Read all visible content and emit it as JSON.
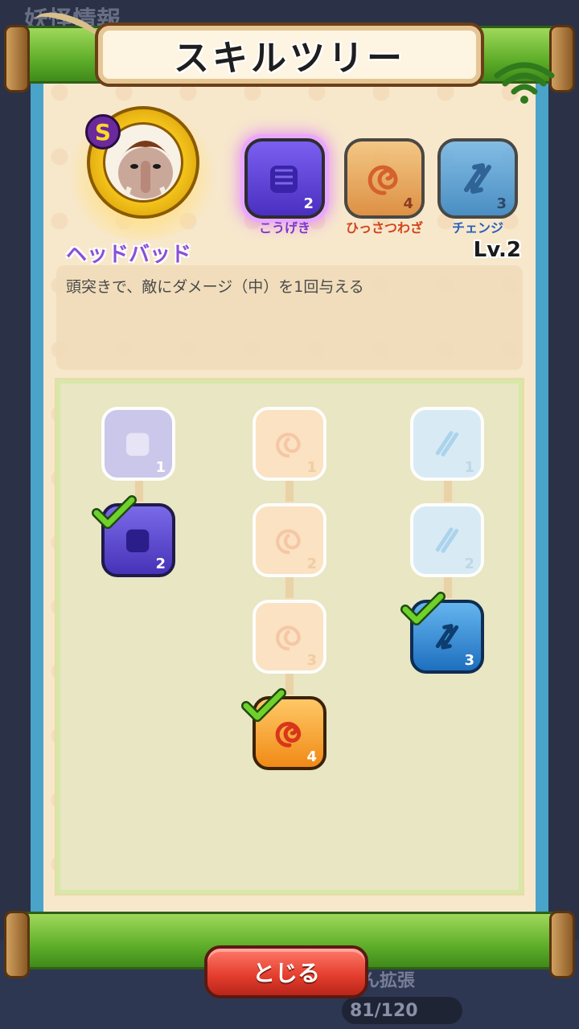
{
  "backdrop": {
    "title": "妖怪情報",
    "expand_label": "ん拡張",
    "capacity": "81/120"
  },
  "header": {
    "title": "スキルツリー"
  },
  "character": {
    "rank": "S",
    "icon": "mammoth-yokai-portrait"
  },
  "categories": [
    {
      "key": "attack",
      "label": "こうげき",
      "level": "2",
      "icon": "fist-icon",
      "color": "#5a3fd0",
      "selected": true
    },
    {
      "key": "special",
      "label": "ひっさつわざ",
      "level": "4",
      "icon": "swirl-icon",
      "color": "#e0822e",
      "selected": false
    },
    {
      "key": "change",
      "label": "チェンジ",
      "level": "3",
      "icon": "swap-arrows-icon",
      "color": "#2c7fc1",
      "selected": false
    }
  ],
  "skill": {
    "name": "ヘッドバッド",
    "level": "Lv.2",
    "description": "頭突きで、敵にダメージ（中）を1回与える"
  },
  "tree": {
    "attack": [
      {
        "num": "1",
        "state": "locked"
      },
      {
        "num": "2",
        "state": "active"
      }
    ],
    "special": [
      {
        "num": "1",
        "state": "locked"
      },
      {
        "num": "2",
        "state": "locked"
      },
      {
        "num": "3",
        "state": "locked"
      },
      {
        "num": "4",
        "state": "active"
      }
    ],
    "change": [
      {
        "num": "1",
        "state": "locked"
      },
      {
        "num": "2",
        "state": "locked"
      },
      {
        "num": "3",
        "state": "active"
      }
    ]
  },
  "close_button": {
    "label": "とじる"
  },
  "colors": {
    "roller_green": "#5fae2a",
    "border_blue": "#4aa3c9",
    "close_red": "#e23c2c",
    "skill_name_purple": "#8b4fd6"
  }
}
